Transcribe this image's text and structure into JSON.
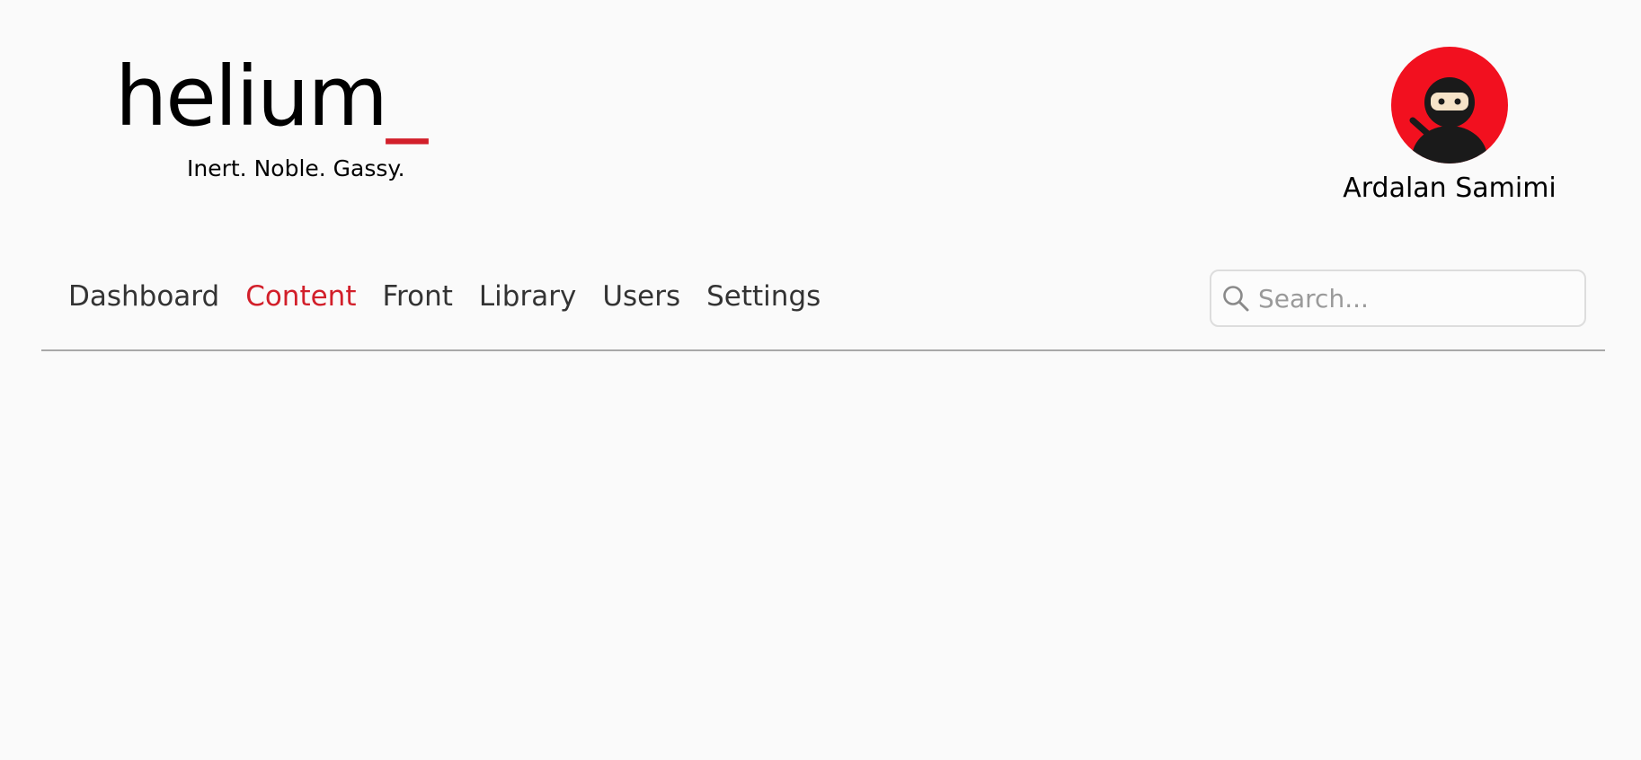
{
  "brand": {
    "name": "helium",
    "cursor": "_",
    "tagline": "Inert. Noble. Gassy."
  },
  "user": {
    "name": "Ardalan Samimi",
    "avatar_icon": "ninja-avatar-icon"
  },
  "nav": {
    "items": [
      {
        "label": "Dashboard",
        "active": false
      },
      {
        "label": "Content",
        "active": true
      },
      {
        "label": "Front",
        "active": false
      },
      {
        "label": "Library",
        "active": false
      },
      {
        "label": "Users",
        "active": false
      },
      {
        "label": "Settings",
        "active": false
      }
    ]
  },
  "search": {
    "placeholder": "Search...",
    "value": "",
    "icon": "search-icon"
  },
  "colors": {
    "accent": "#d21f2a",
    "avatar_bg": "#f2101f",
    "background": "#fafafa",
    "divider": "#a8a8a8"
  }
}
